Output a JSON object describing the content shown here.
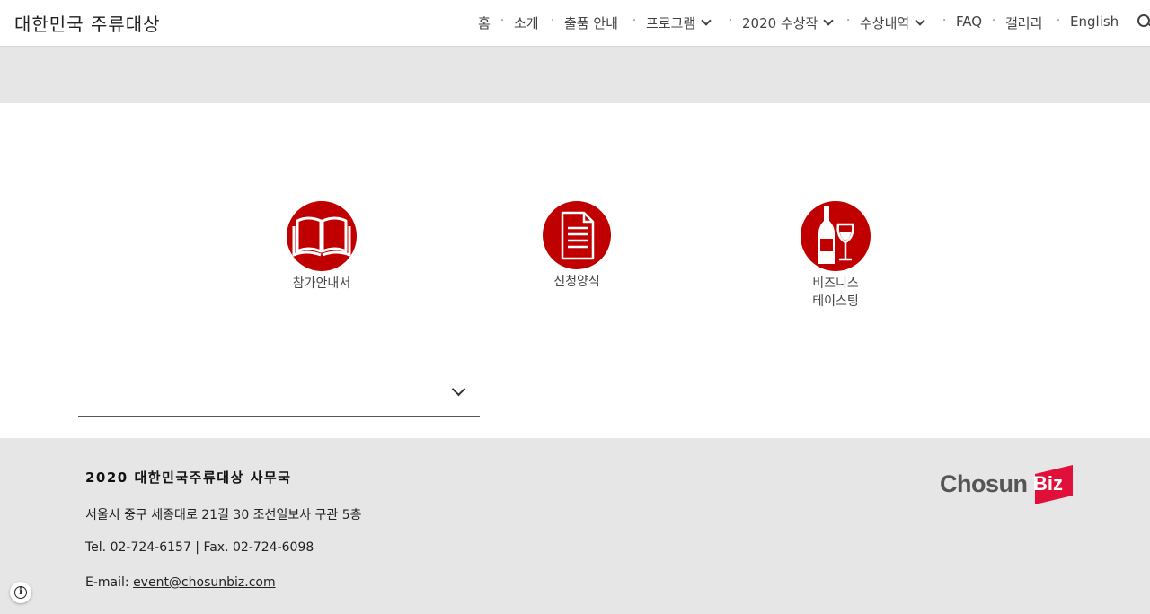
{
  "header": {
    "site_title": "대한민국 주류대상",
    "nav": [
      {
        "label": "홈",
        "has_dropdown": false
      },
      {
        "label": "소개",
        "has_dropdown": false
      },
      {
        "label": "출품 안내",
        "has_dropdown": false
      },
      {
        "label": "프로그램",
        "has_dropdown": true
      },
      {
        "label": "2020 수상작",
        "has_dropdown": true
      },
      {
        "label": "수상내역",
        "has_dropdown": true
      },
      {
        "label": "FAQ",
        "has_dropdown": false
      },
      {
        "label": "갤러리",
        "has_dropdown": false
      },
      {
        "label": "English",
        "has_dropdown": false
      }
    ],
    "separator": "·",
    "search_icon": "search-icon"
  },
  "features": [
    {
      "label": "참가안내서",
      "icon": "book-icon"
    },
    {
      "label": "신청양식",
      "icon": "document-icon"
    },
    {
      "label": "비즈니스\n테이스팅",
      "icon": "wine-icon"
    }
  ],
  "colors": {
    "accent": "#c00000",
    "band": "#e6e6e6"
  },
  "footer": {
    "title": "2020 대한민국주류대상 사무국",
    "address": "서울시 중구 세종대로 21길 30  조선일보사 구관 5층",
    "phone": "Tel. 02-724-6157 | Fax. 02-724-6098",
    "email_label": "E-mail: ",
    "email": "event@chosunbiz.com",
    "logo_text": "Chosun",
    "logo_biz": "Biz"
  },
  "info_button": "i"
}
